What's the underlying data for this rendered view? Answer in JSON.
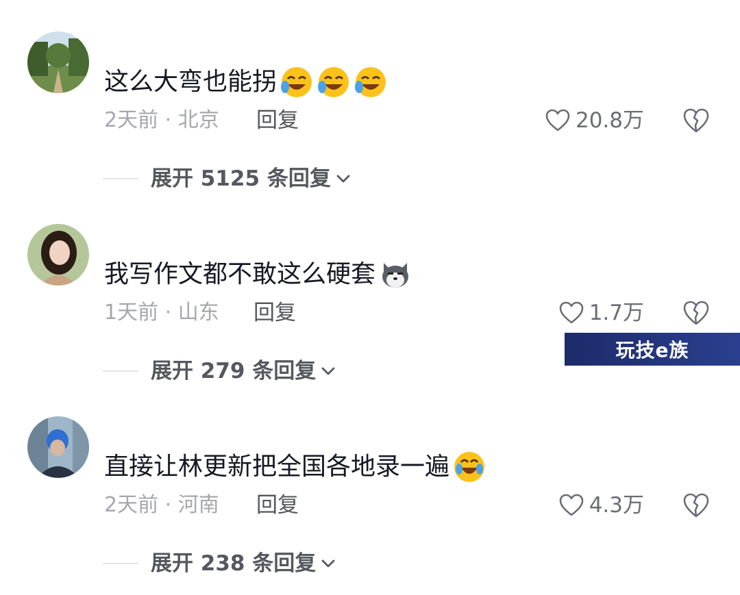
{
  "comments": [
    {
      "text": "这么大弯也能拐",
      "time_location": "2天前 · 北京",
      "reply_label": "回复",
      "likes": "20.8万",
      "expand_label": "展开 5125 条回复",
      "emojis": [
        "laugh-cry-emoji",
        "laugh-cry-emoji",
        "laugh-cry-emoji"
      ]
    },
    {
      "text": "我写作文都不敢这么硬套",
      "time_location": "1天前 · 山东",
      "reply_label": "回复",
      "likes": "1.7万",
      "expand_label": "展开 279 条回复",
      "emojis": [
        "husky-dog-emoji"
      ]
    },
    {
      "text": "直接让林更新把全国各地录一遍",
      "time_location": "2天前 · 河南",
      "reply_label": "回复",
      "likes": "4.3万",
      "expand_label": "展开 238 条回复",
      "emojis": [
        "tears-of-joy-emoji"
      ]
    }
  ],
  "watermark": "玩技e族",
  "colors": {
    "text": "#161823",
    "meta": "#a5a7ad",
    "secondary": "#56585f",
    "watermark_bg": "#1d2b6a"
  }
}
